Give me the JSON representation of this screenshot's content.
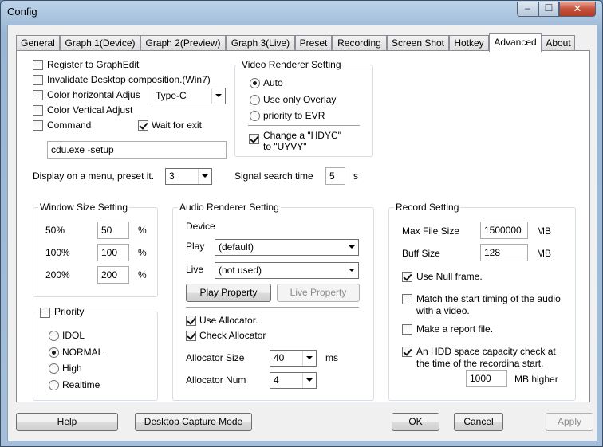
{
  "window": {
    "title": "Config",
    "minimize": "–",
    "maximize": "☐",
    "close": "✕"
  },
  "tabs": [
    {
      "label": "General"
    },
    {
      "label": "Graph 1(Device)"
    },
    {
      "label": "Graph 2(Preview)"
    },
    {
      "label": "Graph 3(Live)"
    },
    {
      "label": "Preset"
    },
    {
      "label": "Recording"
    },
    {
      "label": "Screen Shot"
    },
    {
      "label": "Hotkey"
    },
    {
      "label": "Advanced"
    },
    {
      "label": "About"
    }
  ],
  "active_tab": "Advanced",
  "options": {
    "register_graphedit": {
      "label": "Register to GraphEdit",
      "checked": false
    },
    "invalidate_desktop": {
      "label": "Invalidate Desktop composition.(Win7)",
      "checked": false
    },
    "color_horizontal": {
      "label": "Color horizontal Adjus",
      "checked": false,
      "combo_value": "Type-C"
    },
    "color_vertical": {
      "label": "Color Vertical Adjust",
      "checked": false
    },
    "command": {
      "label": "Command",
      "checked": false
    },
    "wait_for_exit": {
      "label": "Wait for exit",
      "checked": true
    },
    "command_value": "cdu.exe -setup",
    "display_menu": {
      "label": "Display on a menu, preset it.",
      "value": "3"
    },
    "signal_search": {
      "label": "Signal search time",
      "value": "5",
      "unit": "s"
    }
  },
  "video_renderer": {
    "title": "Video Renderer Setting",
    "radios": [
      {
        "label": "Auto",
        "selected": true
      },
      {
        "label": "Use only Overlay",
        "selected": false
      },
      {
        "label": "priority to EVR",
        "selected": false
      }
    ],
    "change_hdyc": {
      "line1": "Change a \"HDYC\"",
      "line2": "to \"UYVY\"",
      "checked": true
    }
  },
  "window_size": {
    "title": "Window Size Setting",
    "rows": [
      {
        "label": "50%",
        "value": "50",
        "unit": "%"
      },
      {
        "label": "100%",
        "value": "100",
        "unit": "%"
      },
      {
        "label": "200%",
        "value": "200",
        "unit": "%"
      }
    ]
  },
  "priority": {
    "title": "Priority",
    "checked": false,
    "radios": [
      {
        "label": "IDOL",
        "selected": false
      },
      {
        "label": "NORMAL",
        "selected": true
      },
      {
        "label": "High",
        "selected": false
      },
      {
        "label": "Realtime",
        "selected": false
      }
    ]
  },
  "audio_renderer": {
    "title": "Audio Renderer Setting",
    "device_label": "Device",
    "play": {
      "label": "Play",
      "value": "(default)"
    },
    "live": {
      "label": "Live",
      "value": "(not used)"
    },
    "play_property": "Play Property",
    "live_property": "Live Property",
    "use_allocator": {
      "label": "Use Allocator.",
      "checked": true
    },
    "check_allocator": {
      "label": "Check Allocator",
      "checked": true
    },
    "allocator_size": {
      "label": "Allocator Size",
      "value": "40",
      "unit": "ms"
    },
    "allocator_num": {
      "label": "Allocator Num",
      "value": "4"
    }
  },
  "record_setting": {
    "title": "Record Setting",
    "max_file_size": {
      "label": "Max File Size",
      "value": "1500000",
      "unit": "MB"
    },
    "buff_size": {
      "label": "Buff Size",
      "value": "128",
      "unit": "MB"
    },
    "use_null_frame": {
      "label": "Use Null frame.",
      "checked": true
    },
    "match_start": {
      "line1": "Match the start timing of the audio",
      "line2": "with a video.",
      "checked": false
    },
    "report_file": {
      "label": "Make a report file.",
      "checked": false
    },
    "hdd_check": {
      "line1": "An HDD space capacity check at",
      "line2": "the time of the recordina start.",
      "checked": true
    },
    "hdd_value": "1000",
    "hdd_unit": "MB higher"
  },
  "buttons": {
    "help": "Help",
    "desktop_capture": "Desktop Capture Mode",
    "ok": "OK",
    "cancel": "Cancel",
    "apply": "Apply"
  }
}
